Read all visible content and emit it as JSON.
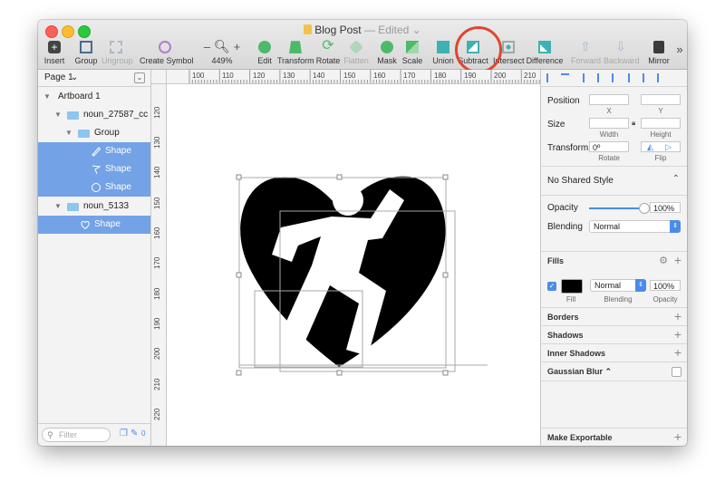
{
  "window": {
    "title": "Blog Post",
    "title_state": "— Edited"
  },
  "toolbar": {
    "insert": "Insert",
    "group": "Group",
    "ungroup": "Ungroup",
    "create_symbol": "Create Symbol",
    "zoom_minus": "–",
    "zoom_plus": "+",
    "zoom_level": "449%",
    "edit": "Edit",
    "transform": "Transform",
    "rotate": "Rotate",
    "flatten": "Flatten",
    "mask": "Mask",
    "scale": "Scale",
    "union": "Union",
    "subtract": "Subtract",
    "intersect": "Intersect",
    "difference": "Difference",
    "forward": "Forward",
    "backward": "Backward",
    "mirror": "Mirror",
    "more": "»",
    "plus_icon": "+"
  },
  "layers": {
    "page_label": "Page 1",
    "page_drop": "⌄",
    "items": [
      {
        "name": "Artboard 1"
      },
      {
        "name": "noun_27587_cc"
      },
      {
        "name": "Group"
      },
      {
        "name": "Shape"
      },
      {
        "name": "Shape"
      },
      {
        "name": "Shape"
      },
      {
        "name": "noun_5133"
      },
      {
        "name": "Shape"
      }
    ],
    "filter_placeholder": "Filter",
    "filter_count": "0"
  },
  "rulers": {
    "top": [
      "100",
      "110",
      "120",
      "130",
      "140",
      "150",
      "160",
      "170",
      "180",
      "190",
      "200",
      "210"
    ],
    "left": [
      "120",
      "130",
      "140",
      "150",
      "160",
      "170",
      "180",
      "190",
      "200",
      "210",
      "220"
    ]
  },
  "inspector": {
    "position_label": "Position",
    "x_label": "X",
    "y_label": "Y",
    "size_label": "Size",
    "width_label": "Width",
    "height_label": "Height",
    "transform_label": "Transform",
    "rotate_value": "0º",
    "rotate_label": "Rotate",
    "flip_label": "Flip",
    "shared_style": "No Shared Style",
    "shared_style_arrow": "⌃",
    "opacity_label": "Opacity",
    "opacity_value": "100%",
    "opacity_fraction": 1.0,
    "blending_label": "Blending",
    "blending_value": "Normal",
    "fills_label": "Fills",
    "fill_blending_value": "Normal",
    "fill_opacity_value": "100%",
    "fill_label": "Fill",
    "fill_blending_label": "Blending",
    "fill_opacity_label": "Opacity",
    "fill_color": "#000000",
    "borders_label": "Borders",
    "shadows_label": "Shadows",
    "inner_shadows_label": "Inner Shadows",
    "gaussian_blur_label": "Gaussian Blur",
    "gaussian_blur_arrow": "⌃",
    "make_exportable_label": "Make Exportable"
  },
  "colors": {
    "selection": "#73a2e6",
    "accent": "#4a8ce8",
    "highlight_circle": "#e2452f"
  }
}
